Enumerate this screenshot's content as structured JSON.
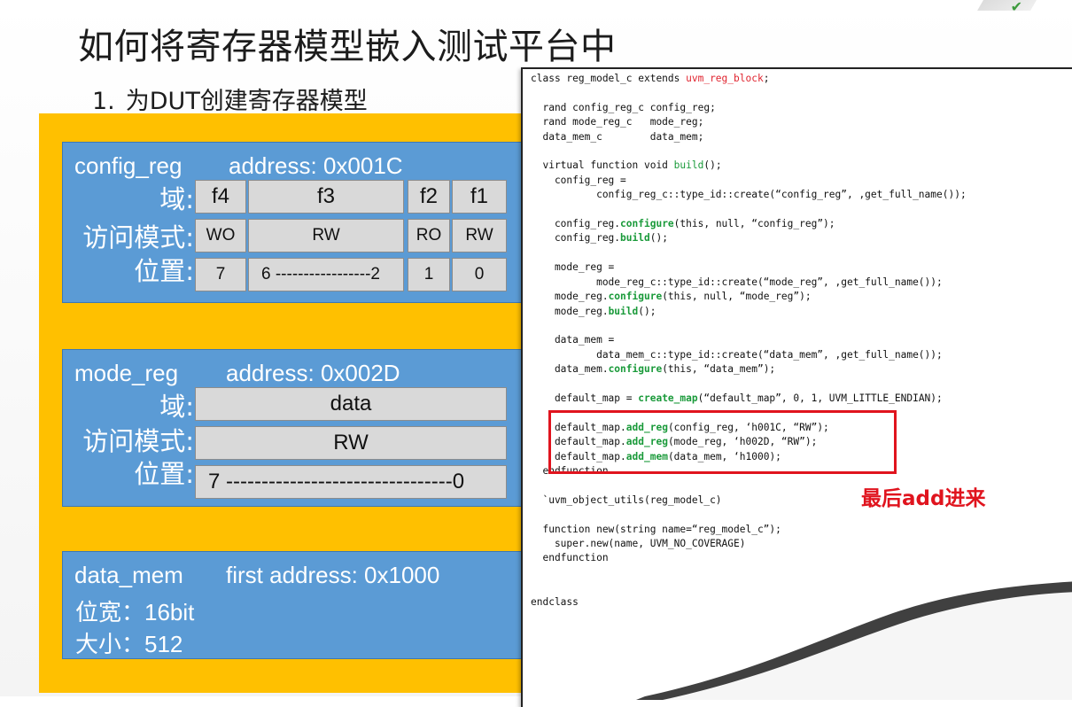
{
  "title": "如何将寄存器模型嵌入测试平台中",
  "step": {
    "number": "1.",
    "text": "为DUT创建寄存器模型"
  },
  "config_reg": {
    "name": "config_reg",
    "address": "address: 0x001C",
    "label_field": "域:",
    "label_access": "访问模式:",
    "label_position": "位置:",
    "fields": [
      "f4",
      "f3",
      "f2",
      "f1"
    ],
    "access": [
      "WO",
      "RW",
      "RO",
      "RW"
    ],
    "positions": [
      "7",
      "6 -----------------2",
      "1",
      "0"
    ]
  },
  "mode_reg": {
    "name": "mode_reg",
    "address": "address: 0x002D",
    "label_field": "域:",
    "label_access": "访问模式:",
    "label_position": "位置:",
    "field": "data",
    "access": "RW",
    "position": "7 --------------------------------0"
  },
  "data_mem": {
    "name": "data_mem",
    "address": "first address: 0x1000",
    "width": "位宽：16bit",
    "size": "大小：512"
  },
  "code": {
    "l01a": "class reg_model_c extends ",
    "l01b": "uvm_reg_block",
    "l01c": ";",
    "l03": "  rand config_reg_c config_reg;",
    "l04": "  rand mode_reg_c   mode_reg;",
    "l05": "  data_mem_c        data_mem;",
    "l07a": "  virtual function void ",
    "l07b": "build",
    "l07c": "();",
    "l08": "    config_reg =",
    "l09": "           config_reg_c::type_id::create(“config_reg”, ,get_full_name());",
    "l11a": "    config_reg.",
    "l11b": "configure",
    "l11c": "(this, null, “config_reg”);",
    "l12a": "    config_reg.",
    "l12b": "build",
    "l12c": "();",
    "l14": "    mode_reg =",
    "l15": "           mode_reg_c::type_id::create(“mode_reg”, ,get_full_name());",
    "l16a": "    mode_reg.",
    "l16b": "configure",
    "l16c": "(this, null, “mode_reg”);",
    "l17a": "    mode_reg.",
    "l17b": "build",
    "l17c": "();",
    "l19": "    data_mem =",
    "l20": "           data_mem_c::type_id::create(“data_mem”, ,get_full_name());",
    "l21a": "    data_mem.",
    "l21b": "configure",
    "l21c": "(this, “data_mem”);",
    "l23a": "    default_map = ",
    "l23b": "create_map",
    "l23c": "(“default_map”, 0, 1, UVM_LITTLE_ENDIAN);",
    "l25a": "    default_map.",
    "l25b": "add_reg",
    "l25c": "(config_reg, ‘h001C, “RW”);",
    "l26a": "    default_map.",
    "l26b": "add_reg",
    "l26c": "(mode_reg, ‘h002D, “RW”);",
    "l27a": "    default_map.",
    "l27b": "add_mem",
    "l27c": "(data_mem, ‘h1000);",
    "l28": "  endfunction",
    "l30": "  `uvm_object_utils(reg_model_c)",
    "l32": "  function new(string name=“reg_model_c”);",
    "l33": "    super.new(name, UVM_NO_COVERAGE)",
    "l34": "  endfunction",
    "l37": "endclass"
  },
  "annotation": "最后add进来",
  "colors": {
    "yellow": "#ffc000",
    "blue": "#5b9bd5",
    "cell": "#d9d9d9",
    "red": "#e0141e",
    "green": "#1a9a3a"
  }
}
